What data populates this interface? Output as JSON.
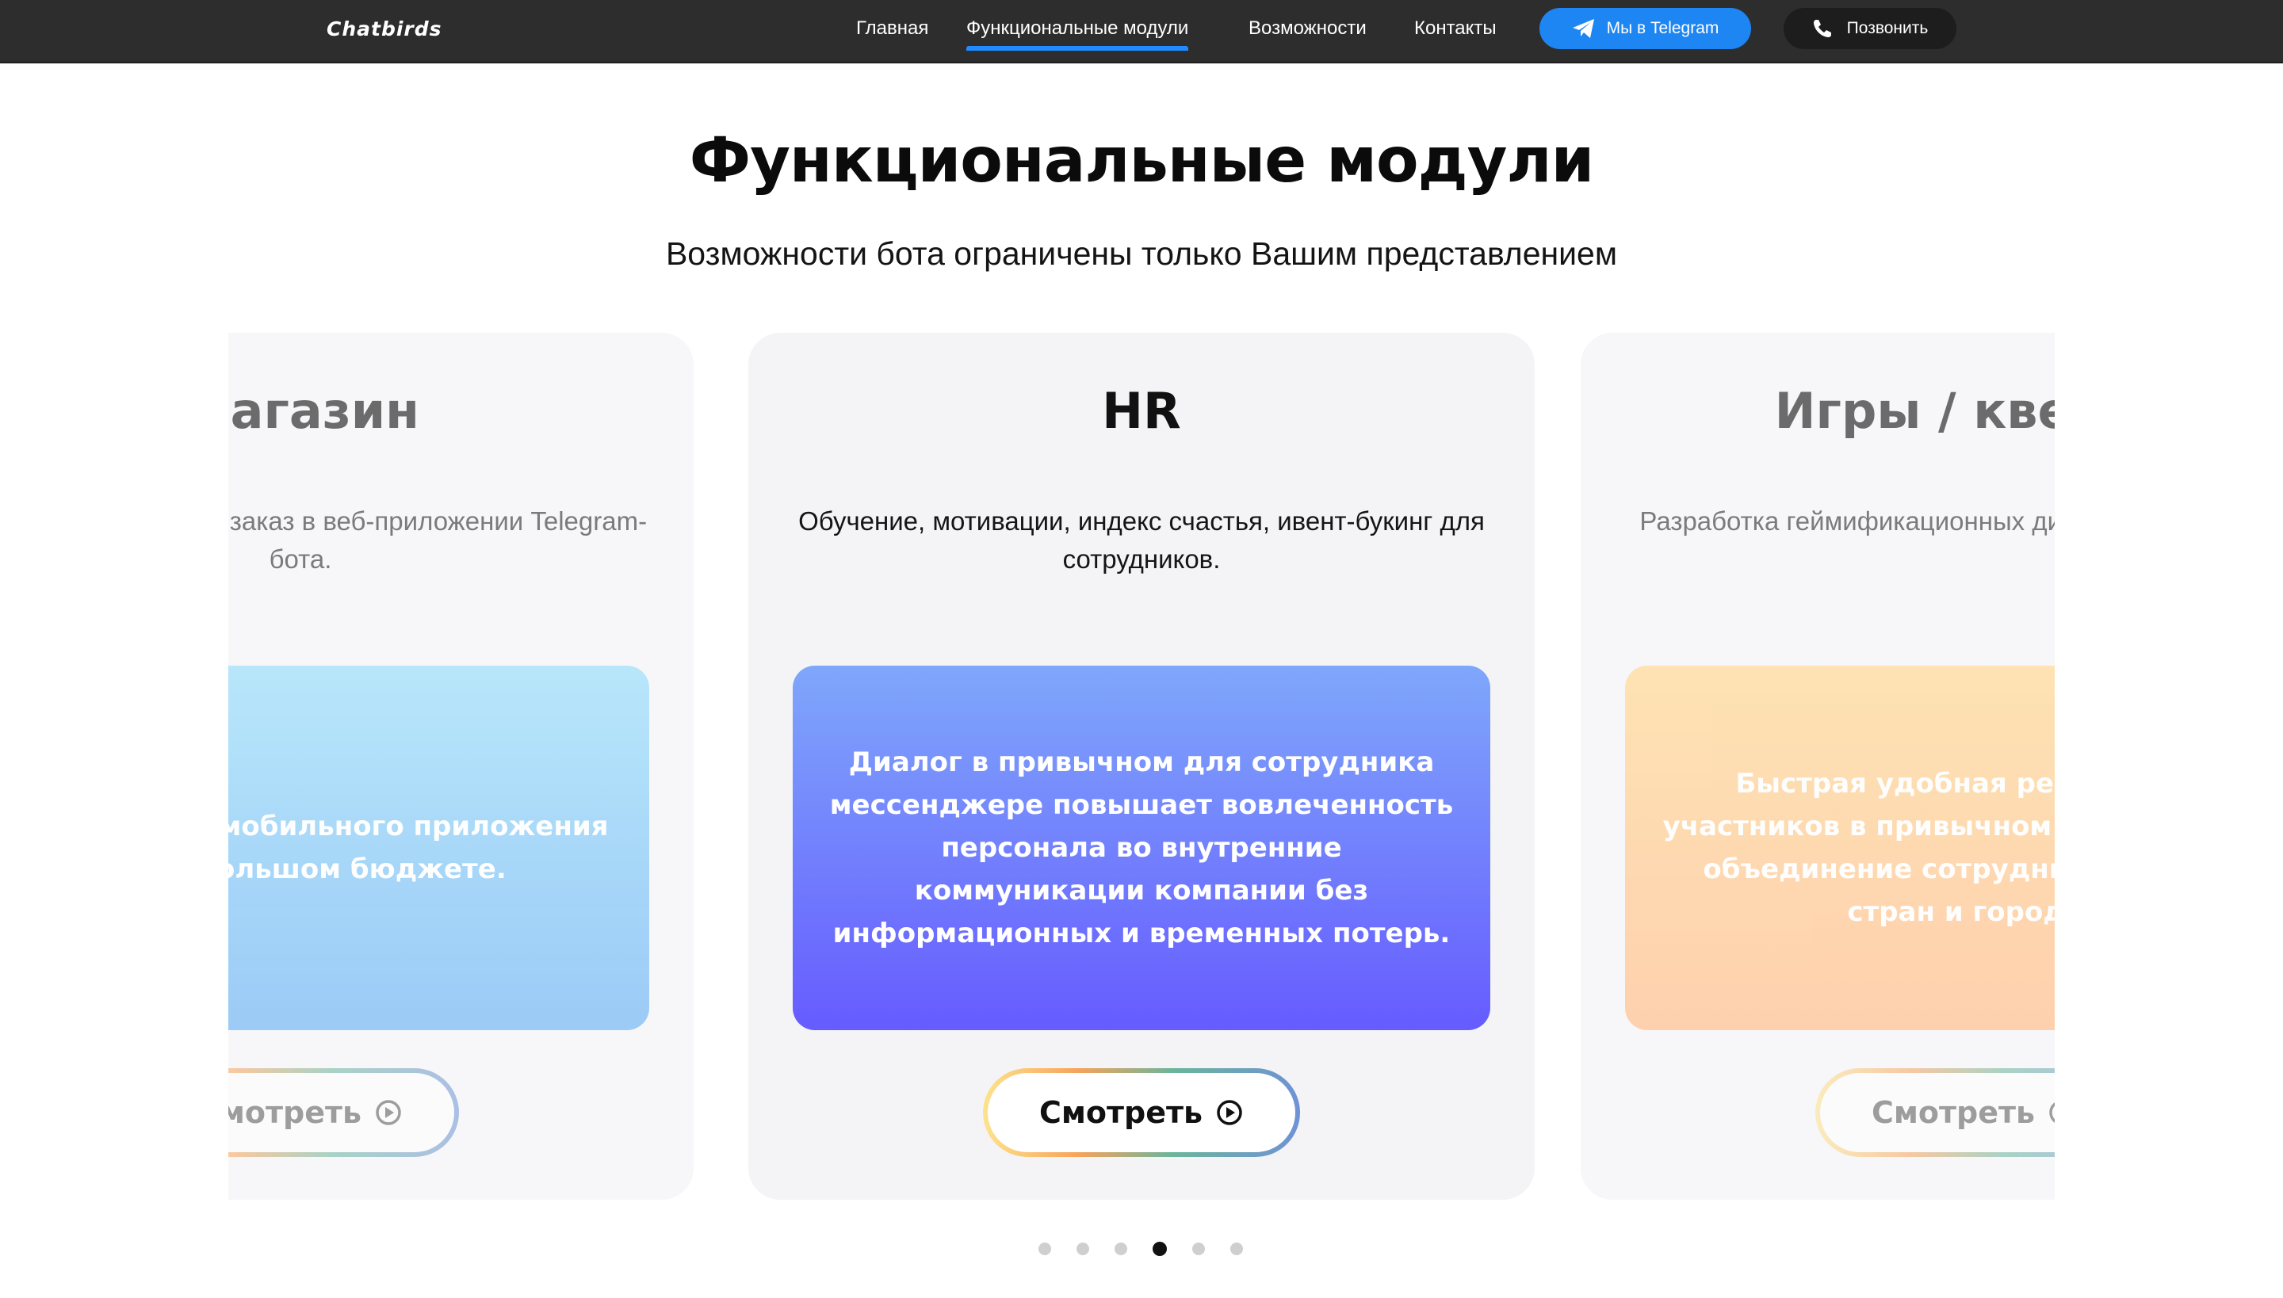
{
  "header": {
    "logo": "Chatbirds",
    "nav": [
      {
        "label": "Главная"
      },
      {
        "label": "Функциональные модули"
      },
      {
        "label": "Возможности"
      },
      {
        "label": "Контакты"
      }
    ],
    "telegram_button": "Мы в Telegram",
    "call_button": "Позвонить"
  },
  "section": {
    "title": "Функциональные модули",
    "subtitle": "Возможности бота ограничены только Вашим представлением"
  },
  "cards": [
    {
      "title": "Магазин",
      "description": "Оформить и оплатить заказ в веб-приложении Telegram-бота.",
      "banner_text": "Альтернатива мобильного приложения при небольшом бюджете.",
      "button_label": "Смотреть"
    },
    {
      "title": "HR",
      "description": "Обучение, мотивации, индекс счастья, ивент-букинг для сотрудников.",
      "banner_text": "Диалог в привычном для сотрудника мессенджере повышает вовлеченность персонала во внутренние коммуникации компании без информационных и временных потерь.",
      "button_label": "Смотреть"
    },
    {
      "title": "Игры / квесты",
      "description": "Разработка геймификационных диалога и приложений",
      "banner_text": "Быстрая удобная регистрация участников в привычном мессенджере, объединение сотрудников разных стран и городов",
      "button_label": "Смотреть"
    }
  ],
  "pagination": {
    "total": 6,
    "active_index": 3
  },
  "colors": {
    "navbar": "#2d2d2d",
    "accent_blue": "#1e86f2",
    "active_underline": "#1f8bff",
    "card_bg": "#f4f4f6"
  }
}
